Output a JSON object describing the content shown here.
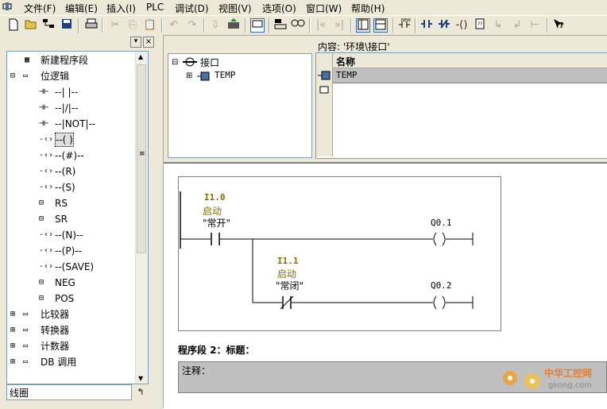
{
  "menubar": {
    "items": [
      "文件(F)",
      "编辑(E)",
      "插入(I)",
      "PLC",
      "调试(D)",
      "视图(V)",
      "选项(O)",
      "窗口(W)",
      "帮助(H)"
    ]
  },
  "left_panel": {
    "tree": [
      {
        "label": "新建程序段",
        "icon": "new-network-icon"
      },
      {
        "label": "位逻辑",
        "icon": "bit-logic-folder-icon",
        "expanded": true
      },
      {
        "label": "--|  |--",
        "icon": "contact-icon"
      },
      {
        "label": "--|/|--",
        "icon": "contact-icon"
      },
      {
        "label": "--|NOT|--",
        "icon": "contact-icon"
      },
      {
        "label": "--( )",
        "icon": "coil-icon",
        "selected": true
      },
      {
        "label": "--(#)--",
        "icon": "coil-icon"
      },
      {
        "label": "--(R)",
        "icon": "coil-icon"
      },
      {
        "label": "--(S)",
        "icon": "coil-icon"
      },
      {
        "label": "RS",
        "icon": "box-icon"
      },
      {
        "label": "SR",
        "icon": "box-icon"
      },
      {
        "label": "--(N)--",
        "icon": "coil-icon"
      },
      {
        "label": "--(P)--",
        "icon": "coil-icon"
      },
      {
        "label": "--(SAVE)",
        "icon": "coil-icon"
      },
      {
        "label": "NEG",
        "icon": "box-icon"
      },
      {
        "label": "POS",
        "icon": "box-icon"
      },
      {
        "label": "比较器",
        "icon": "comparator-folder-icon"
      },
      {
        "label": "转换器",
        "icon": "converter-folder-icon"
      },
      {
        "label": "计数器",
        "icon": "counter-folder-icon"
      },
      {
        "label": "DB 调用",
        "icon": "db-folder-icon"
      }
    ],
    "status": "线圈"
  },
  "interface": {
    "root": "接口",
    "child": "TEMP",
    "content_path": "内容: '环境\\接口'",
    "col_name": "名称",
    "row1": "TEMP"
  },
  "network1": {
    "contact1_addr": "I1.0",
    "contact1_sym": "启动",
    "contact1_cmt": "\"常开\"",
    "coil1": "Q0.1",
    "contact2_addr": "I1.1",
    "contact2_sym": "启动",
    "contact2_cmt": "\"常闭\"",
    "coil2": "Q0.2"
  },
  "network2": {
    "title": "程序段 2：标题：",
    "comment": "注释："
  },
  "watermark": {
    "text": "中华工控网",
    "url": "gkong.com"
  },
  "colors": {
    "operand": "#7f6f00",
    "selection": "#316ac5",
    "comment_bg": "#c0c0c0"
  }
}
